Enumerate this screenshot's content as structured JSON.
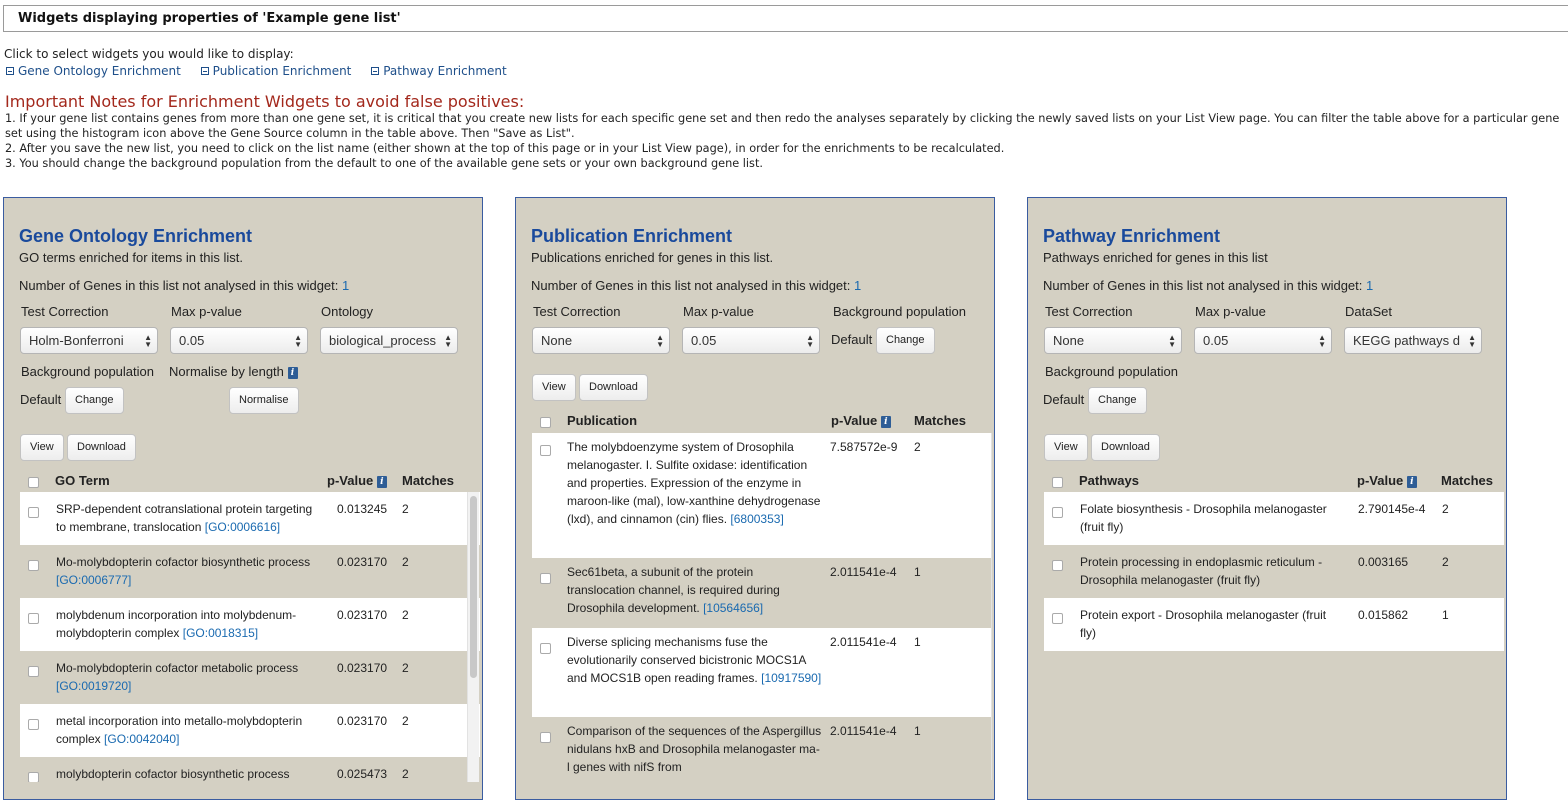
{
  "page_title": "Widgets displaying properties of 'Example gene list'",
  "intro": "Click to select widgets you would like to display:",
  "toggles": [
    "Gene Ontology Enrichment",
    "Publication Enrichment",
    "Pathway Enrichment"
  ],
  "notes": {
    "title": "Important Notes for Enrichment Widgets to avoid false positives:",
    "items": [
      "1. If your gene list contains genes from more than one gene set, it is critical that you create new lists for each specific gene set and then redo the analyses separately by clicking the newly saved lists on your List View page. You can filter the table above for a particular gene set using the histogram icon above the Gene Source column in the table above. Then \"Save as List\".",
      "2. After you save the new list, you need to click on the list name (either shown at the top of this page or in your List View page), in order for the enrichments to be recalculated.",
      "3. You should change the background population from the default to one of the available gene sets or your own background gene list."
    ]
  },
  "colors": {
    "panel_bg": "#d4d0c3",
    "title_blue": "#1a4a9c",
    "link_blue": "#1a6ab0",
    "notes_red": "#a3281c"
  },
  "common": {
    "not_analysed_label": "Number of Genes in this list not analysed in this widget:",
    "not_analysed_count": "1",
    "test_correction_label": "Test Correction",
    "max_p_label": "Max p-value",
    "background_label": "Background population",
    "default_label": "Default",
    "change_button": "Change",
    "view_button": "View",
    "download_button": "Download",
    "p_value_header": "p-Value",
    "matches_header": "Matches",
    "info_icon": "i"
  },
  "go": {
    "title": "Gene Ontology Enrichment",
    "subtitle": "GO terms enriched for items in this list.",
    "test_correction": "Holm-Bonferroni",
    "max_p": "0.05",
    "ontology_label": "Ontology",
    "ontology": "biological_process",
    "normalise_label": "Normalise by length",
    "normalise_button": "Normalise",
    "term_header": "GO Term",
    "rows": [
      {
        "text": "SRP-dependent cotranslational protein targeting to membrane, translocation ",
        "id": "[GO:0006616]",
        "p": "0.013245",
        "m": "2"
      },
      {
        "text": "Mo-molybdopterin cofactor biosynthetic process ",
        "id": "[GO:0006777]",
        "p": "0.023170",
        "m": "2"
      },
      {
        "text": "molybdenum incorporation into molybdenum-molybdopterin complex ",
        "id": "[GO:0018315]",
        "p": "0.023170",
        "m": "2"
      },
      {
        "text": "Mo-molybdopterin cofactor metabolic process ",
        "id": "[GO:0019720]",
        "p": "0.023170",
        "m": "2"
      },
      {
        "text": "metal incorporation into metallo-molybdopterin complex ",
        "id": "[GO:0042040]",
        "p": "0.023170",
        "m": "2"
      },
      {
        "text": "molybdopterin cofactor biosynthetic process",
        "id": "",
        "p": "0.025473",
        "m": "2"
      }
    ]
  },
  "pub": {
    "title": "Publication Enrichment",
    "subtitle": "Publications enriched for genes in this list.",
    "test_correction": "None",
    "max_p": "0.05",
    "column_header": "Publication",
    "rows": [
      {
        "text": "The molybdoenzyme system of Drosophila melanogaster. I. Sulfite oxidase: identification and properties. Expression of the enzyme in maroon-like (mal), low-xanthine dehydrogenase (lxd), and cinnamon (cin) flies. ",
        "id": "[6800353]",
        "p": "7.587572e-9",
        "m": "2"
      },
      {
        "text": "Sec61beta, a subunit of the protein translocation channel, is required during Drosophila development. ",
        "id": "[10564656]",
        "p": "2.011541e-4",
        "m": "1"
      },
      {
        "text": "Diverse splicing mechanisms fuse the evolutionarily conserved bicistronic MOCS1A and MOCS1B open reading frames. ",
        "id": "[10917590]",
        "p": "2.011541e-4",
        "m": "1"
      },
      {
        "text": "Comparison of the sequences of the Aspergillus nidulans hxB and Drosophila melanogaster ma-l genes with nifS from",
        "id": "",
        "p": "2.011541e-4",
        "m": "1"
      }
    ]
  },
  "path": {
    "title": "Pathway Enrichment",
    "subtitle": "Pathways enriched for genes in this list",
    "test_correction": "None",
    "max_p": "0.05",
    "dataset_label": "DataSet",
    "dataset": "KEGG pathways d",
    "column_header": "Pathways",
    "rows": [
      {
        "text": "Folate biosynthesis - Drosophila melanogaster (fruit fly)",
        "p": "2.790145e-4",
        "m": "2"
      },
      {
        "text": "Protein processing in endoplasmic reticulum - Drosophila melanogaster (fruit fly)",
        "p": "0.003165",
        "m": "2"
      },
      {
        "text": "Protein export - Drosophila melanogaster (fruit fly)",
        "p": "0.015862",
        "m": "1"
      }
    ]
  }
}
